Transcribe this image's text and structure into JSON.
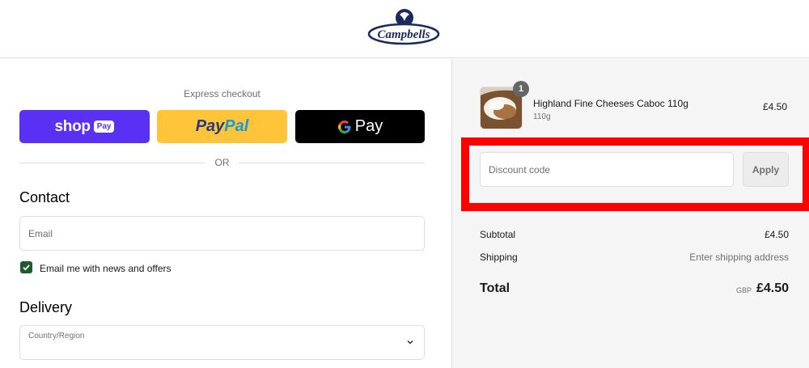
{
  "brand": {
    "name": "Campbells"
  },
  "express_checkout": {
    "title": "Express checkout",
    "shop_pay": {
      "word": "shop",
      "badge": "Pay"
    },
    "paypal": {
      "part1": "Pay",
      "part2": "Pal"
    },
    "google_pay": {
      "word": "Pay"
    }
  },
  "divider": {
    "or_text": "OR"
  },
  "contact": {
    "title": "Contact",
    "email_placeholder": "Email",
    "news_checkbox_label": "Email me with news and offers",
    "news_checked": true
  },
  "delivery": {
    "title": "Delivery",
    "country_label": "Country/Region"
  },
  "order": {
    "item": {
      "name": "Highland Fine Cheeses Caboc 110g",
      "variant": "110g",
      "price": "£4.50",
      "quantity": "1"
    },
    "discount": {
      "placeholder": "Discount code",
      "apply_label": "Apply"
    },
    "subtotal": {
      "label": "Subtotal",
      "value": "£4.50"
    },
    "shipping": {
      "label": "Shipping",
      "value": "Enter shipping address"
    },
    "total": {
      "label": "Total",
      "currency": "GBP",
      "value": "£4.50"
    }
  },
  "colors": {
    "shop_pay": "#5a31f4",
    "paypal": "#ffc439",
    "google_pay": "#000000",
    "checkbox": "#1f5a2b",
    "highlight": "#ff0000"
  }
}
